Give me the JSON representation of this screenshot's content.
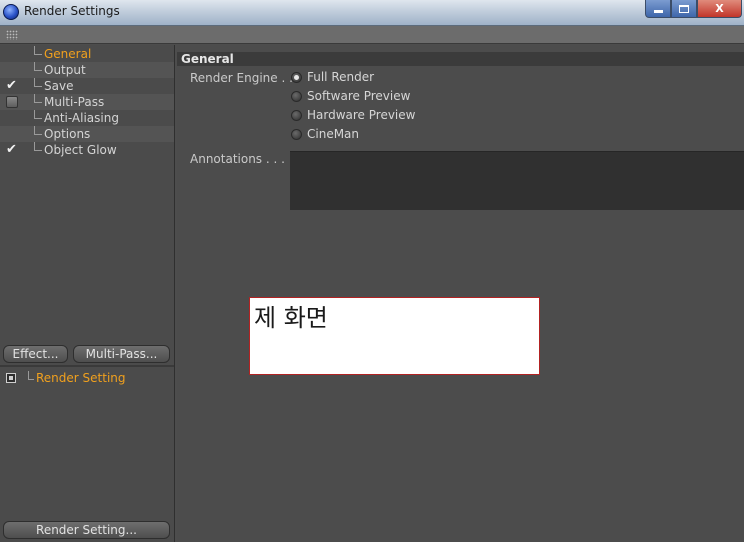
{
  "window": {
    "title": "Render Settings",
    "close_glyph": "X"
  },
  "sidebar": {
    "items": [
      {
        "label": "General",
        "active": true,
        "checkbox": "none"
      },
      {
        "label": "Output",
        "active": false,
        "checkbox": "none"
      },
      {
        "label": "Save",
        "active": false,
        "checkbox": "checked"
      },
      {
        "label": "Multi-Pass",
        "active": false,
        "checkbox": "unchecked"
      },
      {
        "label": "Anti-Aliasing",
        "active": false,
        "checkbox": "none"
      },
      {
        "label": "Options",
        "active": false,
        "checkbox": "none"
      },
      {
        "label": "Object Glow",
        "active": false,
        "checkbox": "checked"
      }
    ],
    "check_glyph": "✔",
    "effect_button": "Effect...",
    "multipass_button": "Multi-Pass...",
    "node_label": "Render Setting",
    "render_setting_button": "Render Setting..."
  },
  "main": {
    "section_title": "General",
    "render_engine_label": "Render Engine . .",
    "render_engine_options": [
      {
        "label": "Full Render",
        "selected": true
      },
      {
        "label": "Software Preview",
        "selected": false
      },
      {
        "label": "Hardware Preview",
        "selected": false
      },
      {
        "label": "CineMan",
        "selected": false
      }
    ],
    "annotations_label": "Annotations . . . . .",
    "annotations_value": ""
  },
  "overlay": {
    "text": "제 화면"
  },
  "colors": {
    "accent": "#f0a01e",
    "panel_bg": "#4c4c4c",
    "overlay_border": "#b22222"
  }
}
